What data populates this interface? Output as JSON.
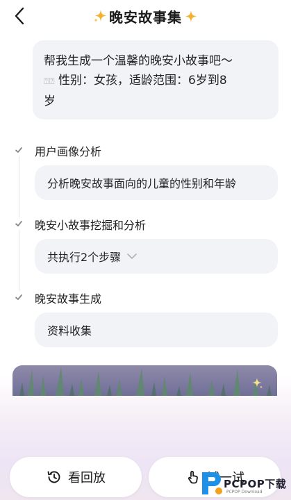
{
  "header": {
    "title": "晚安故事集",
    "back_icon": "chevron-left-icon",
    "title_decoration_icon": "sparkle-icon",
    "accent_color": "#f2b230"
  },
  "prompt": {
    "line1": "帮我生成一个温馨的晚安小故事吧～",
    "emoji_placeholder": "⍰⍰",
    "line2_rest": " 性别：女孩，适龄范围：6岁到8",
    "line3": "岁"
  },
  "steps": [
    {
      "title": "用户画像分析",
      "content": "分析晚安故事面向的儿童的性别和年龄",
      "icon": "check-icon"
    },
    {
      "title": "晚安小故事挖掘和分析",
      "content": "共执行2个步骤",
      "icon": "check-icon",
      "expand_icon": "chevron-down-icon"
    },
    {
      "title": "晚安故事生成",
      "content": "资料收集",
      "icon": "check-icon"
    }
  ],
  "banner": {
    "image": "story-illustration",
    "icon": "sparkle-icon"
  },
  "actions": {
    "replay_label": "看回放",
    "replay_icon": "history-icon",
    "try_label": "试一试",
    "try_icon": "tap-icon"
  },
  "watermark": {
    "brand": "PCPOP下载",
    "sub": "PCPOP Download"
  }
}
